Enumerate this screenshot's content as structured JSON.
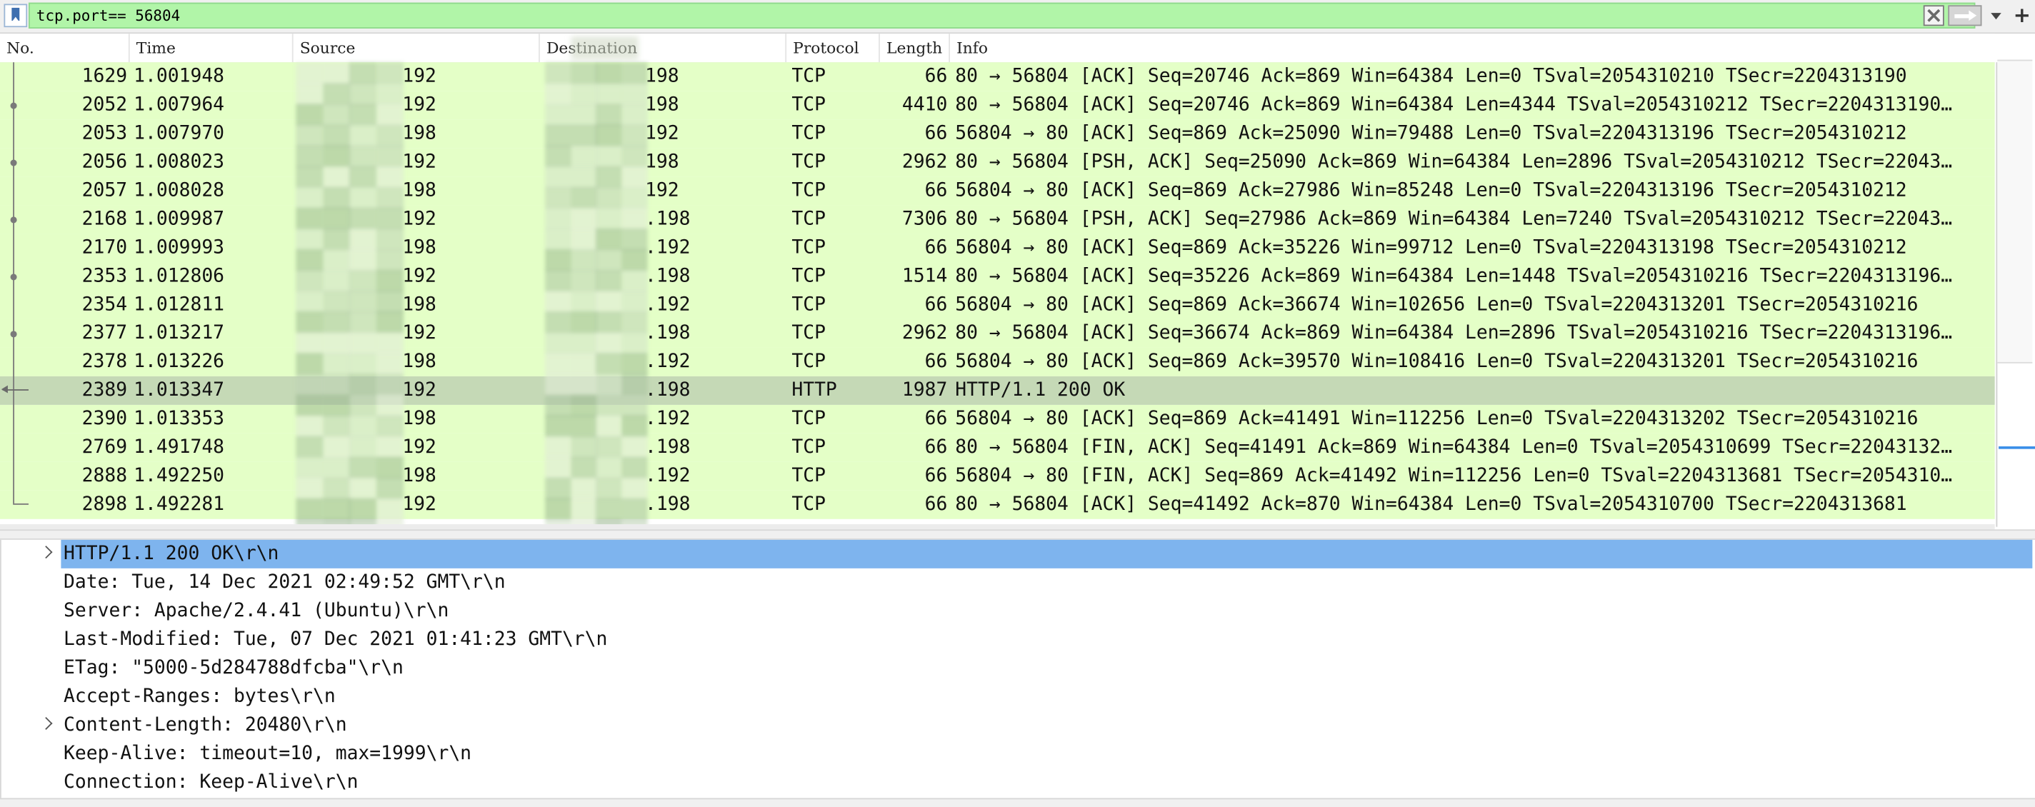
{
  "filter": {
    "value": "tcp.port== 56804",
    "bookmark_icon": "bookmark-icon",
    "clear_icon": "close-icon",
    "apply_icon": "arrow-right-icon",
    "dropdown_icon": "chevron-down-icon",
    "add_icon": "plus-icon",
    "add_label": "+",
    "background_color": "#b1f5a8"
  },
  "columns": {
    "no": "No.",
    "time": "Time",
    "source": "Source",
    "destination": "Destination",
    "protocol": "Protocol",
    "length": "Length",
    "info": "Info"
  },
  "packets": [
    {
      "no": "1629",
      "time": "1.001948",
      "source": "192",
      "destination": "198",
      "protocol": "TCP",
      "length": "66",
      "info": "80 → 56804 [ACK] Seq=20746 Ack=869 Win=64384 Len=0 TSval=2054310210 TSecr=2204313190"
    },
    {
      "no": "2052",
      "time": "1.007964",
      "source": "192",
      "destination": "198",
      "protocol": "TCP",
      "length": "4410",
      "info": "80 → 56804 [ACK] Seq=20746 Ack=869 Win=64384 Len=4344 TSval=2054310212 TSecr=2204313190…"
    },
    {
      "no": "2053",
      "time": "1.007970",
      "source": "198",
      "destination": "192",
      "protocol": "TCP",
      "length": "66",
      "info": "56804 → 80 [ACK] Seq=869 Ack=25090 Win=79488 Len=0 TSval=2204313196 TSecr=2054310212"
    },
    {
      "no": "2056",
      "time": "1.008023",
      "source": "192",
      "destination": "198",
      "protocol": "TCP",
      "length": "2962",
      "info": "80 → 56804 [PSH, ACK] Seq=25090 Ack=869 Win=64384 Len=2896 TSval=2054310212 TSecr=22043…"
    },
    {
      "no": "2057",
      "time": "1.008028",
      "source": "198",
      "destination": "192",
      "protocol": "TCP",
      "length": "66",
      "info": "56804 → 80 [ACK] Seq=869 Ack=27986 Win=85248 Len=0 TSval=2204313196 TSecr=2054310212"
    },
    {
      "no": "2168",
      "time": "1.009987",
      "source": "192",
      "destination": ".198",
      "protocol": "TCP",
      "length": "7306",
      "info": "80 → 56804 [PSH, ACK] Seq=27986 Ack=869 Win=64384 Len=7240 TSval=2054310212 TSecr=22043…"
    },
    {
      "no": "2170",
      "time": "1.009993",
      "source": "198",
      "destination": ".192",
      "protocol": "TCP",
      "length": "66",
      "info": "56804 → 80 [ACK] Seq=869 Ack=35226 Win=99712 Len=0 TSval=2204313198 TSecr=2054310212"
    },
    {
      "no": "2353",
      "time": "1.012806",
      "source": "192",
      "destination": ".198",
      "protocol": "TCP",
      "length": "1514",
      "info": "80 → 56804 [ACK] Seq=35226 Ack=869 Win=64384 Len=1448 TSval=2054310216 TSecr=2204313196…"
    },
    {
      "no": "2354",
      "time": "1.012811",
      "source": "198",
      "destination": ".192",
      "protocol": "TCP",
      "length": "66",
      "info": "56804 → 80 [ACK] Seq=869 Ack=36674 Win=102656 Len=0 TSval=2204313201 TSecr=2054310216"
    },
    {
      "no": "2377",
      "time": "1.013217",
      "source": "192",
      "destination": ".198",
      "protocol": "TCP",
      "length": "2962",
      "info": "80 → 56804 [ACK] Seq=36674 Ack=869 Win=64384 Len=2896 TSval=2054310216 TSecr=2204313196…"
    },
    {
      "no": "2378",
      "time": "1.013226",
      "source": "198",
      "destination": ".192",
      "protocol": "TCP",
      "length": "66",
      "info": "56804 → 80 [ACK] Seq=869 Ack=39570 Win=108416 Len=0 TSval=2204313201 TSecr=2054310216"
    },
    {
      "no": "2389",
      "time": "1.013347",
      "source": "192",
      "destination": ".198",
      "protocol": "HTTP",
      "length": "1987",
      "info": "HTTP/1.1 200 OK",
      "selected": true
    },
    {
      "no": "2390",
      "time": "1.013353",
      "source": "198",
      "destination": ".192",
      "protocol": "TCP",
      "length": "66",
      "info": "56804 → 80 [ACK] Seq=869 Ack=41491 Win=112256 Len=0 TSval=2204313202 TSecr=2054310216"
    },
    {
      "no": "2769",
      "time": "1.491748",
      "source": "192",
      "destination": ".198",
      "protocol": "TCP",
      "length": "66",
      "info": "80 → 56804 [FIN, ACK] Seq=41491 Ack=869 Win=64384 Len=0 TSval=2054310699 TSecr=22043132…"
    },
    {
      "no": "2888",
      "time": "1.492250",
      "source": "198",
      "destination": ".192",
      "protocol": "TCP",
      "length": "66",
      "info": "56804 → 80 [FIN, ACK] Seq=869 Ack=41492 Win=112256 Len=0 TSval=2204313681 TSecr=2054310…"
    },
    {
      "no": "2898",
      "time": "1.492281",
      "source": "192",
      "destination": ".198",
      "protocol": "TCP",
      "length": "66",
      "info": "80 → 56804 [ACK] Seq=41492 Ack=870 Win=64384 Len=0 TSval=2054310700 TSecr=2204313681"
    }
  ],
  "details": [
    {
      "text": "HTTP/1.1 200 OK\\r\\n",
      "expandable": true,
      "selected": true
    },
    {
      "text": "Date: Tue, 14 Dec 2021 02:49:52 GMT\\r\\n",
      "expandable": false
    },
    {
      "text": "Server: Apache/2.4.41 (Ubuntu)\\r\\n",
      "expandable": false
    },
    {
      "text": "Last-Modified: Tue, 07 Dec 2021 01:41:23 GMT\\r\\n",
      "expandable": false
    },
    {
      "text": "ETag: \"5000-5d284788dfcba\"\\r\\n",
      "expandable": false
    },
    {
      "text": "Accept-Ranges: bytes\\r\\n",
      "expandable": false
    },
    {
      "text": "Content-Length: 20480\\r\\n",
      "expandable": true
    },
    {
      "text": "Keep-Alive: timeout=10, max=1999\\r\\n",
      "expandable": false
    },
    {
      "text": "Connection: Keep-Alive\\r\\n",
      "expandable": false
    }
  ],
  "colors": {
    "tcp_row": "#e4ffc7",
    "selected_row": "#c5d9b6",
    "selected_detail": "#7eb4ee",
    "minimap_marker": "#3a8ee8"
  }
}
